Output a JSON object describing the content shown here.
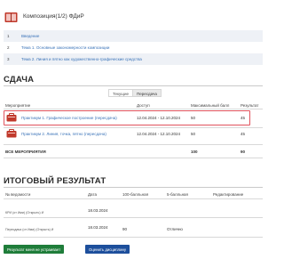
{
  "course": {
    "title": "Композиция(1/2) ФДиР",
    "icon": "book-icon"
  },
  "topics": [
    {
      "num": "1",
      "title": "Введение"
    },
    {
      "num": "2",
      "title": "Тема 1. Основные закономерности композиции"
    },
    {
      "num": "3",
      "title": "Тема 2. Линия и пятно как художественно-графические средства"
    }
  ],
  "submission": {
    "title": "СДАЧА",
    "tabs": [
      "Текущие",
      "Пересдача"
    ],
    "active_tab": "Пересдача",
    "columns": {
      "event": "Мероприятие",
      "access": "Доступ",
      "max_score": "Максимальный балл",
      "result": "Результат"
    },
    "rows": [
      {
        "title": "Практикум 1. Графическое построение (пересдача)",
        "access": "12.04.2024 - 12.10.2024",
        "max_score": "50",
        "result": "45",
        "icon": "homework-icon"
      },
      {
        "title": "Практикум 2. Линия, точка, пятно (пересдача)",
        "access": "12.04.2024 - 12.10.2024",
        "max_score": "50",
        "result": "45",
        "icon": "homework-icon"
      }
    ],
    "total": {
      "label": "ВСЕ МЕРОПРИЯТИЯ",
      "max_score": "100",
      "result": "90"
    }
  },
  "final": {
    "title": "ИТОГОВЫЙ РЕЗУЛЬТАТ",
    "columns": {
      "statement": "№ ведомости",
      "date": "Дата",
      "score100": "100-балльная",
      "score5": "5-балльная",
      "edit": "Редактирование"
    },
    "rows": [
      {
        "statement": "КРИ (от Ими) (Открыть) И",
        "date": "18.03.2024",
        "score100": "",
        "score5": ""
      },
      {
        "statement": "Пересдача (от Ими) (Открыть) И",
        "date": "18.03.2024",
        "score100": "90",
        "score5": "Отлично"
      }
    ]
  },
  "buttons": {
    "not_satisfied": "Результат меня не устраивает",
    "rate": "Оценить дисциплину"
  },
  "colors": {
    "link": "#3a73b8",
    "highlight": "#e0525c",
    "btn_green": "#1f7d3a",
    "btn_blue": "#1d4f9c",
    "icon_red": "#c0392b"
  }
}
